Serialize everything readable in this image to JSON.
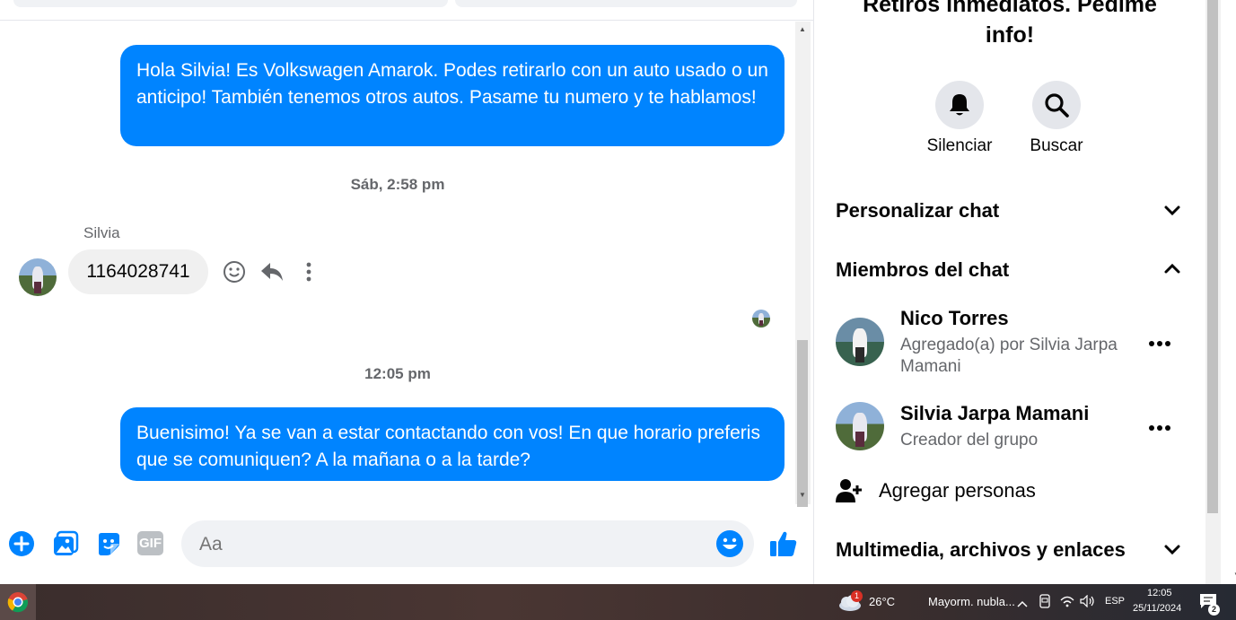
{
  "chat": {
    "messages": [
      {
        "type": "outgoing",
        "text": "Hola Silvia! Es Volkswagen Amarok. Podes retirarlo con un auto usado o un anticipo! También tenemos otros autos. Pasame tu numero y te hablamos!"
      },
      {
        "type": "timestamp",
        "text": "Sáb, 2:58 pm"
      },
      {
        "type": "incoming",
        "sender": "Silvia",
        "text": "1164028741"
      },
      {
        "type": "timestamp",
        "text": "12:05 pm"
      },
      {
        "type": "outgoing",
        "text": "Buenisimo! Ya se van a estar contactando con vos! En que horario preferis que se comuniquen? A la mañana o a la tarde?"
      }
    ]
  },
  "composer": {
    "placeholder": "Aa",
    "icons": [
      "plus-circle-icon",
      "photo-icon",
      "sticker-icon",
      "gif-icon",
      "emoji-icon",
      "like-icon"
    ],
    "gif_label": "GIF"
  },
  "panel": {
    "title_line1": "Retiros inmediatos. Pedime",
    "title_line2": "info!",
    "mute_label": "Silenciar",
    "search_label": "Buscar",
    "customize_label": "Personalizar chat",
    "members_label": "Miembros del chat",
    "members": [
      {
        "name": "Nico Torres",
        "sub": "Agregado(a) por Silvia Jarpa Mamani"
      },
      {
        "name": "Silvia Jarpa Mamani",
        "sub": "Creador del grupo"
      }
    ],
    "add_people_label": "Agregar personas",
    "media_label": "Multimedia, archivos y enlaces"
  },
  "taskbar": {
    "weather_temp": "26°C",
    "weather_desc": "Mayorm. nubla...",
    "weather_badge": "1",
    "language": "ESP",
    "time": "12:05",
    "date": "25/11/2024",
    "notification_count": "2"
  },
  "colors": {
    "messenger_blue": "#0084ff",
    "bubble_gray": "#f0f0f0",
    "secondary_text": "#65676b"
  }
}
